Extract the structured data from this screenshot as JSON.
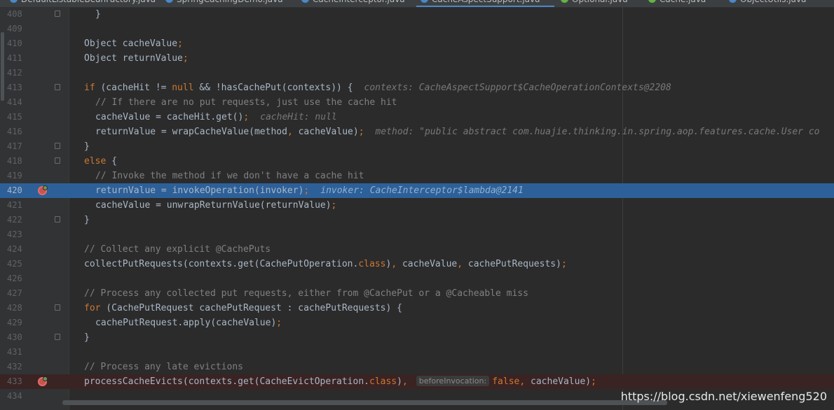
{
  "tabs": [
    {
      "label": "DefaultListableBeanFactory.java",
      "icon_color": "#4a88c7"
    },
    {
      "label": "SpringCachingDemo.java",
      "icon_color": "#4a88c7"
    },
    {
      "label": "CacheInterceptor.java",
      "icon_color": "#4a88c7"
    },
    {
      "label": "CacheAspectSupport.java",
      "icon_color": "#4a88c7",
      "active": true
    },
    {
      "label": "Optional.java",
      "icon_color": "#62b543"
    },
    {
      "label": "Cache.java",
      "icon_color": "#62b543"
    },
    {
      "label": "ObjectUtils.java",
      "icon_color": "#4a88c7"
    }
  ],
  "lines": [
    {
      "num": "408",
      "indent": 1,
      "fold": true,
      "parts": [
        {
          "t": "}"
        }
      ]
    },
    {
      "num": "409",
      "parts": []
    },
    {
      "num": "410",
      "parts": [
        {
          "t": "Object cacheValue"
        },
        {
          "t": ";",
          "c": "kw"
        }
      ]
    },
    {
      "num": "411",
      "parts": [
        {
          "t": "Object returnValue"
        },
        {
          "t": ";",
          "c": "kw"
        }
      ]
    },
    {
      "num": "412",
      "parts": []
    },
    {
      "num": "413",
      "fold": true,
      "parts": [
        {
          "t": "if",
          "c": "kw"
        },
        {
          "t": " (cacheHit != "
        },
        {
          "t": "null",
          "c": "kw"
        },
        {
          "t": " && !hasCachePut(contexts)) {"
        },
        {
          "t": "contexts: CacheAspectSupport$CacheOperationContexts@2208",
          "c": "hint"
        }
      ]
    },
    {
      "num": "414",
      "indent": 1,
      "parts": [
        {
          "t": "// If there are no put requests, just use the cache hit",
          "c": "cm"
        }
      ]
    },
    {
      "num": "415",
      "indent": 1,
      "parts": [
        {
          "t": "cacheValue = cacheHit.get()"
        },
        {
          "t": ";",
          "c": "kw"
        },
        {
          "t": "cacheHit: null",
          "c": "hint"
        }
      ]
    },
    {
      "num": "416",
      "indent": 1,
      "parts": [
        {
          "t": "returnValue = wrapCacheValue(method"
        },
        {
          "t": ",",
          "c": "kw"
        },
        {
          "t": " cacheValue)"
        },
        {
          "t": ";",
          "c": "kw"
        },
        {
          "t": "method: \"public abstract com.huajie.thinking.in.spring.aop.features.cache.User co",
          "c": "hint"
        }
      ]
    },
    {
      "num": "417",
      "fold": true,
      "parts": [
        {
          "t": "}"
        }
      ]
    },
    {
      "num": "418",
      "fold": true,
      "parts": [
        {
          "t": "else",
          "c": "kw"
        },
        {
          "t": " {"
        }
      ]
    },
    {
      "num": "419",
      "indent": 1,
      "parts": [
        {
          "t": "// Invoke the method if we don't have a cache hit",
          "c": "cm"
        }
      ]
    },
    {
      "num": "420",
      "indent": 1,
      "current": true,
      "breakpoint": true,
      "parts": [
        {
          "t": "returnValue = invokeOperation(invoker)"
        },
        {
          "t": ";",
          "c": "kw"
        },
        {
          "t": "invoker: CacheInterceptor$lambda@2141",
          "c": "hint"
        }
      ]
    },
    {
      "num": "421",
      "indent": 1,
      "parts": [
        {
          "t": "cacheValue = unwrapReturnValue(returnValue)"
        },
        {
          "t": ";",
          "c": "kw"
        }
      ]
    },
    {
      "num": "422",
      "fold": true,
      "parts": [
        {
          "t": "}"
        }
      ]
    },
    {
      "num": "423",
      "parts": []
    },
    {
      "num": "424",
      "parts": [
        {
          "t": "// Collect any explicit @CachePuts",
          "c": "cm"
        }
      ]
    },
    {
      "num": "425",
      "parts": [
        {
          "t": "collectPutRequests(contexts.get(CachePutOperation."
        },
        {
          "t": "class",
          "c": "kw"
        },
        {
          "t": ")"
        },
        {
          "t": ",",
          "c": "kw"
        },
        {
          "t": " cacheValue"
        },
        {
          "t": ",",
          "c": "kw"
        },
        {
          "t": " cachePutRequests)"
        },
        {
          "t": ";",
          "c": "kw"
        }
      ]
    },
    {
      "num": "426",
      "parts": []
    },
    {
      "num": "427",
      "parts": [
        {
          "t": "// Process any collected put requests, either from @CachePut or a @Cacheable miss",
          "c": "cm"
        }
      ]
    },
    {
      "num": "428",
      "fold": true,
      "parts": [
        {
          "t": "for",
          "c": "kw"
        },
        {
          "t": " (CachePutRequest cachePutRequest : cachePutRequests) {"
        }
      ]
    },
    {
      "num": "429",
      "indent": 1,
      "parts": [
        {
          "t": "cachePutRequest.apply(cacheValue)"
        },
        {
          "t": ";",
          "c": "kw"
        }
      ]
    },
    {
      "num": "430",
      "fold": true,
      "parts": [
        {
          "t": "}"
        }
      ]
    },
    {
      "num": "431",
      "parts": []
    },
    {
      "num": "432",
      "parts": [
        {
          "t": "// Process any late evictions",
          "c": "cm"
        }
      ]
    },
    {
      "num": "433",
      "breakpoint": true,
      "bpline": true,
      "parts": [
        {
          "t": "processCacheEvicts(contexts.get(CacheEvictOperation."
        },
        {
          "t": "class",
          "c": "kw"
        },
        {
          "t": ")"
        },
        {
          "t": ",",
          "c": "kw"
        },
        {
          "t": "beforeInvocation:",
          "c": "inlay"
        },
        {
          "t": "false",
          "c": "kw"
        },
        {
          "t": ",",
          "c": "kw"
        },
        {
          "t": " cacheValue)"
        },
        {
          "t": ";",
          "c": "kw"
        }
      ]
    },
    {
      "num": "434",
      "parts": []
    }
  ],
  "watermark": "https://blog.csdn.net/xiewenfeng520"
}
